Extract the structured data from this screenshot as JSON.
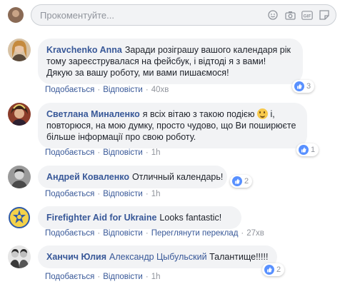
{
  "composer": {
    "placeholder": "Прокоментуйте..."
  },
  "comments": [
    {
      "author": "Kravchenko Anna",
      "text": "Заради розіграшу вашого календаря рік тому зареєструвалася на фейсбук, і відтоді я з вами! Дякую за вашу роботу, ми вами пишаємося!",
      "like": "Подобається",
      "reply": "Відповісти",
      "time": "40хв",
      "reactions": "3"
    },
    {
      "author": "Светлана Миналенко",
      "text_before": "я всіх вітаю з такою подією",
      "text_after": "і, повторюся, на мою думку, просто чудово, що Ви поширюєте більше інформації про свою роботу.",
      "like": "Подобається",
      "reply": "Відповісти",
      "time": "1h",
      "reactions": "1"
    },
    {
      "author": "Андрей Коваленко",
      "text": "Отличный календарь!",
      "like": "Подобається",
      "reply": "Відповісти",
      "time": "1h",
      "reactions": "2"
    },
    {
      "author": "Firefighter Aid for Ukraine",
      "text": "Looks fantastic!",
      "like": "Подобається",
      "reply": "Відповісти",
      "translate": "Переглянути переклад",
      "time": "27хв"
    },
    {
      "author": "Ханчич Юлия",
      "tagged": "Александр Цыбульский",
      "text": "Талантище!!!!!",
      "like": "Подобається",
      "reply": "Відповісти",
      "time": "1h",
      "reactions": "2"
    }
  ]
}
